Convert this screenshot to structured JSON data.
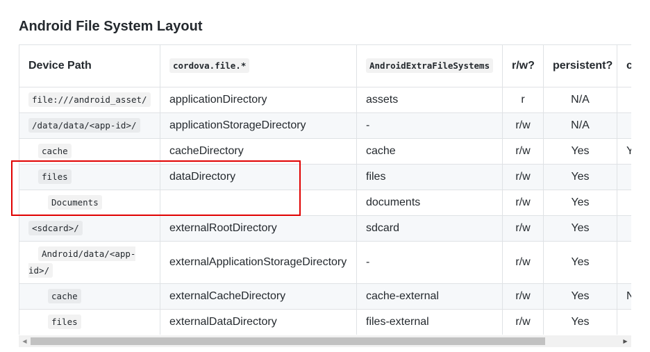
{
  "page": {
    "title": "Android File System Layout"
  },
  "table": {
    "headers": [
      "Device Path",
      "cordova.file.*",
      "AndroidExtraFileSystems",
      "r/w?",
      "persistent?",
      "c"
    ],
    "rows": [
      [
        "file:///android_asset/",
        "applicationDirectory",
        "assets",
        "r",
        "N/A",
        ""
      ],
      [
        "/data/data/<app-id>/",
        "applicationStorageDirectory",
        "-",
        "r/w",
        "N/A",
        ""
      ],
      [
        "cache",
        "cacheDirectory",
        "cache",
        "r/w",
        "Yes",
        "Y"
      ],
      [
        "files",
        "dataDirectory",
        "files",
        "r/w",
        "Yes",
        ""
      ],
      [
        "Documents",
        "",
        "documents",
        "r/w",
        "Yes",
        ""
      ],
      [
        "<sdcard>/",
        "externalRootDirectory",
        "sdcard",
        "r/w",
        "Yes",
        ""
      ],
      [
        "Android/data/<app-id>/",
        "externalApplicationStorageDirectory",
        "-",
        "r/w",
        "Yes",
        ""
      ],
      [
        "cache",
        "externalCacheDirectory",
        "cache-external",
        "r/w",
        "Yes",
        "N"
      ],
      [
        "files",
        "externalDataDirectory",
        "files-external",
        "r/w",
        "Yes",
        ""
      ]
    ]
  },
  "colors": {
    "highlight": "#e00000",
    "border": "#dfe2e5",
    "stripe": "#f6f8fa"
  },
  "icons": {
    "scroll_left": "triangle-left",
    "scroll_right": "triangle-right"
  }
}
